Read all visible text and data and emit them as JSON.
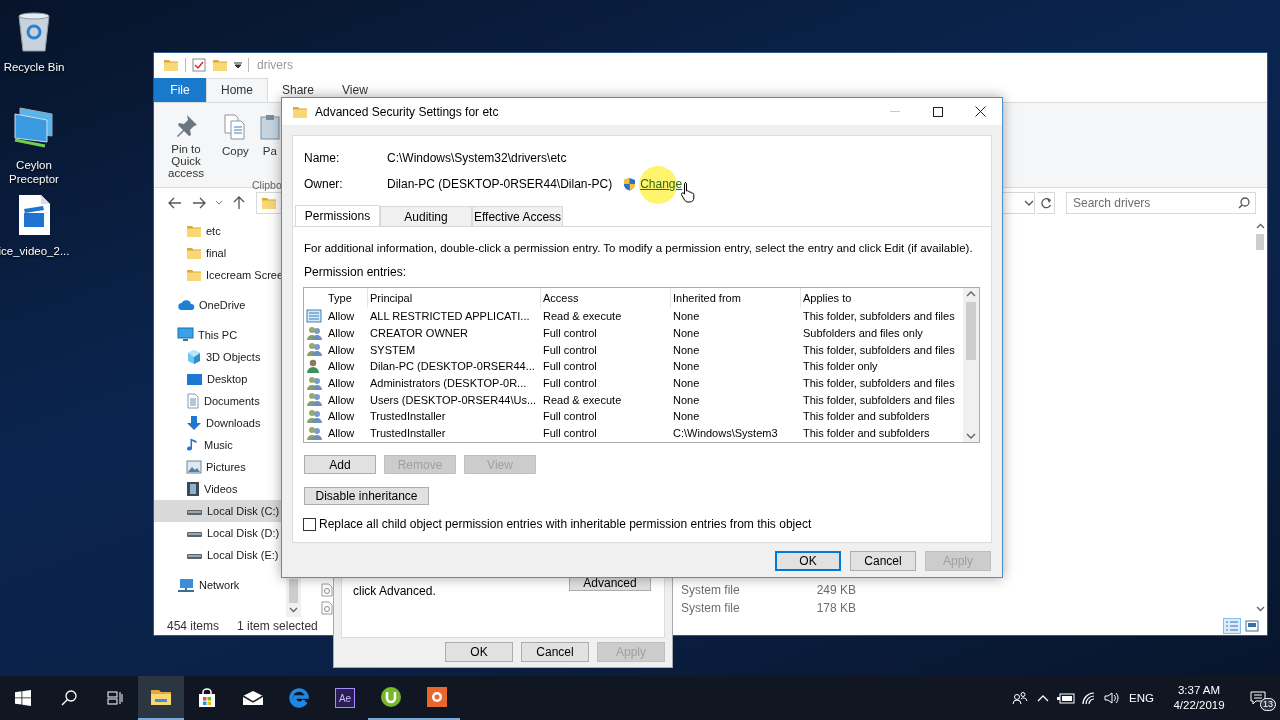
{
  "desktop": {
    "icons": [
      {
        "kind": "recycle-bin",
        "label": "Recycle Bin"
      },
      {
        "kind": "monitors",
        "label": "Ceylon Preceptor"
      },
      {
        "kind": "video-file",
        "label": "ice_video_2..."
      }
    ]
  },
  "explorer": {
    "title": "drivers",
    "ribbon_tabs": [
      {
        "kind": "file",
        "label": "File",
        "selected": false
      },
      {
        "kind": "tab",
        "label": "Home",
        "selected": true
      },
      {
        "kind": "tab",
        "label": "Share",
        "selected": false
      },
      {
        "kind": "tab",
        "label": "View",
        "selected": false
      }
    ],
    "ribbon_commands": [
      {
        "kind": "pin",
        "label": "Pin to Quick access"
      },
      {
        "kind": "copy",
        "label": "Copy"
      },
      {
        "kind": "paste",
        "label": "Pa"
      }
    ],
    "ribbon_group": "Clipbo",
    "search": {
      "placeholder": "Search drivers"
    },
    "quick_access": [
      {
        "kind": "folder",
        "label": "etc",
        "selected": false
      },
      {
        "kind": "folder",
        "label": "final",
        "selected": false
      },
      {
        "kind": "folder",
        "label": "Icecream Scree",
        "selected": false
      }
    ],
    "nav_items": [
      {
        "kind": "onedrive",
        "label": "OneDrive",
        "selected": false
      },
      {
        "kind": "pc",
        "label": "This PC",
        "selected": false,
        "children": [
          {
            "kind": "cube",
            "label": "3D Objects",
            "selected": false
          },
          {
            "kind": "desktop",
            "label": "Desktop",
            "selected": false
          },
          {
            "kind": "documents",
            "label": "Documents",
            "selected": false
          },
          {
            "kind": "downloads",
            "label": "Downloads",
            "selected": false
          },
          {
            "kind": "music",
            "label": "Music",
            "selected": false
          },
          {
            "kind": "pictures",
            "label": "Pictures",
            "selected": false
          },
          {
            "kind": "videos",
            "label": "Videos",
            "selected": false
          },
          {
            "kind": "disk",
            "label": "Local Disk (C:)",
            "selected": true
          },
          {
            "kind": "disk",
            "label": "Local Disk (D:)",
            "selected": false
          },
          {
            "kind": "disk",
            "label": "Local Disk (E:)",
            "selected": false
          }
        ]
      },
      {
        "kind": "network",
        "label": "Network",
        "selected": false
      }
    ],
    "files": [
      {
        "type": "System file",
        "size": "249 KB"
      },
      {
        "type": "System file",
        "size": "178 KB"
      }
    ],
    "status": {
      "item_count": "454 items",
      "selection": "1 item selected"
    }
  },
  "properties_dialog": {
    "text": "click Advanced.",
    "advanced_button": "Advanced",
    "buttons": [
      {
        "label": "OK",
        "disabled": false
      },
      {
        "label": "Cancel",
        "disabled": false
      },
      {
        "label": "Apply",
        "disabled": true
      }
    ]
  },
  "security_dialog": {
    "title": "Advanced Security Settings for etc",
    "name_label": "Name:",
    "name": "C:\\Windows\\System32\\drivers\\etc",
    "owner_label": "Owner:",
    "owner": "Dilan-PC (DESKTOP-0RSER44\\Dilan-PC)",
    "change_link": "Change",
    "tabs": [
      {
        "label": "Permissions",
        "selected": true
      },
      {
        "label": "Auditing",
        "selected": false
      },
      {
        "label": "Effective Access",
        "selected": false
      }
    ],
    "info": "For additional information, double-click a permission entry. To modify a permission entry, select the entry and click Edit (if available).",
    "entries_label": "Permission entries:",
    "table": {
      "columns": [
        "Type",
        "Principal",
        "Access",
        "Inherited from",
        "Applies to"
      ],
      "rows": [
        {
          "kind": "package",
          "type": "Allow",
          "principal": "ALL RESTRICTED APPLICATI...",
          "access": "Read & execute",
          "inherited_from": "None",
          "applies_to": "This folder, subfolders and files"
        },
        {
          "kind": "group",
          "type": "Allow",
          "principal": "CREATOR OWNER",
          "access": "Full control",
          "inherited_from": "None",
          "applies_to": "Subfolders and files only"
        },
        {
          "kind": "group",
          "type": "Allow",
          "principal": "SYSTEM",
          "access": "Full control",
          "inherited_from": "None",
          "applies_to": "This folder, subfolders and files"
        },
        {
          "kind": "user",
          "type": "Allow",
          "principal": "Dilan-PC (DESKTOP-0RSER44...",
          "access": "Full control",
          "inherited_from": "None",
          "applies_to": "This folder only"
        },
        {
          "kind": "group",
          "type": "Allow",
          "principal": "Administrators (DESKTOP-0R...",
          "access": "Full control",
          "inherited_from": "None",
          "applies_to": "This folder, subfolders and files"
        },
        {
          "kind": "group",
          "type": "Allow",
          "principal": "Users (DESKTOP-0RSER44\\Us...",
          "access": "Read & execute",
          "inherited_from": "None",
          "applies_to": "This folder, subfolders and files"
        },
        {
          "kind": "group",
          "type": "Allow",
          "principal": "TrustedInstaller",
          "access": "Full control",
          "inherited_from": "None",
          "applies_to": "This folder and subfolders"
        },
        {
          "kind": "group",
          "type": "Allow",
          "principal": "TrustedInstaller",
          "access": "Full control",
          "inherited_from": "C:\\Windows\\System3",
          "applies_to": "This folder and subfolders"
        }
      ]
    },
    "entry_buttons": [
      {
        "label": "Add",
        "disabled": false
      },
      {
        "label": "Remove",
        "disabled": true
      },
      {
        "label": "View",
        "disabled": true
      }
    ],
    "inheritance_button": "Disable inheritance",
    "replace_checkbox": {
      "label": "Replace all child object permission entries with inheritable permission entries from this object",
      "checked": false
    },
    "buttons": [
      {
        "label": "OK",
        "default": true,
        "disabled": false
      },
      {
        "label": "Cancel",
        "default": false,
        "disabled": false
      },
      {
        "label": "Apply",
        "default": false,
        "disabled": true
      }
    ]
  },
  "taskbar": {
    "apps": [
      {
        "kind": "explorer",
        "running": true,
        "active": true
      },
      {
        "kind": "store",
        "running": false,
        "active": false
      },
      {
        "kind": "mail",
        "running": false,
        "active": false
      },
      {
        "kind": "browser",
        "running": false,
        "active": false
      },
      {
        "kind": "lettered",
        "label": "Ae",
        "running": false,
        "active": false
      },
      {
        "kind": "green-app",
        "running": true,
        "active": false
      },
      {
        "kind": "orange-app",
        "running": true,
        "active": false
      }
    ],
    "tray": {
      "language": "ENG",
      "time": "3:37 AM",
      "date": "4/22/2019",
      "notification_count": "13"
    }
  }
}
